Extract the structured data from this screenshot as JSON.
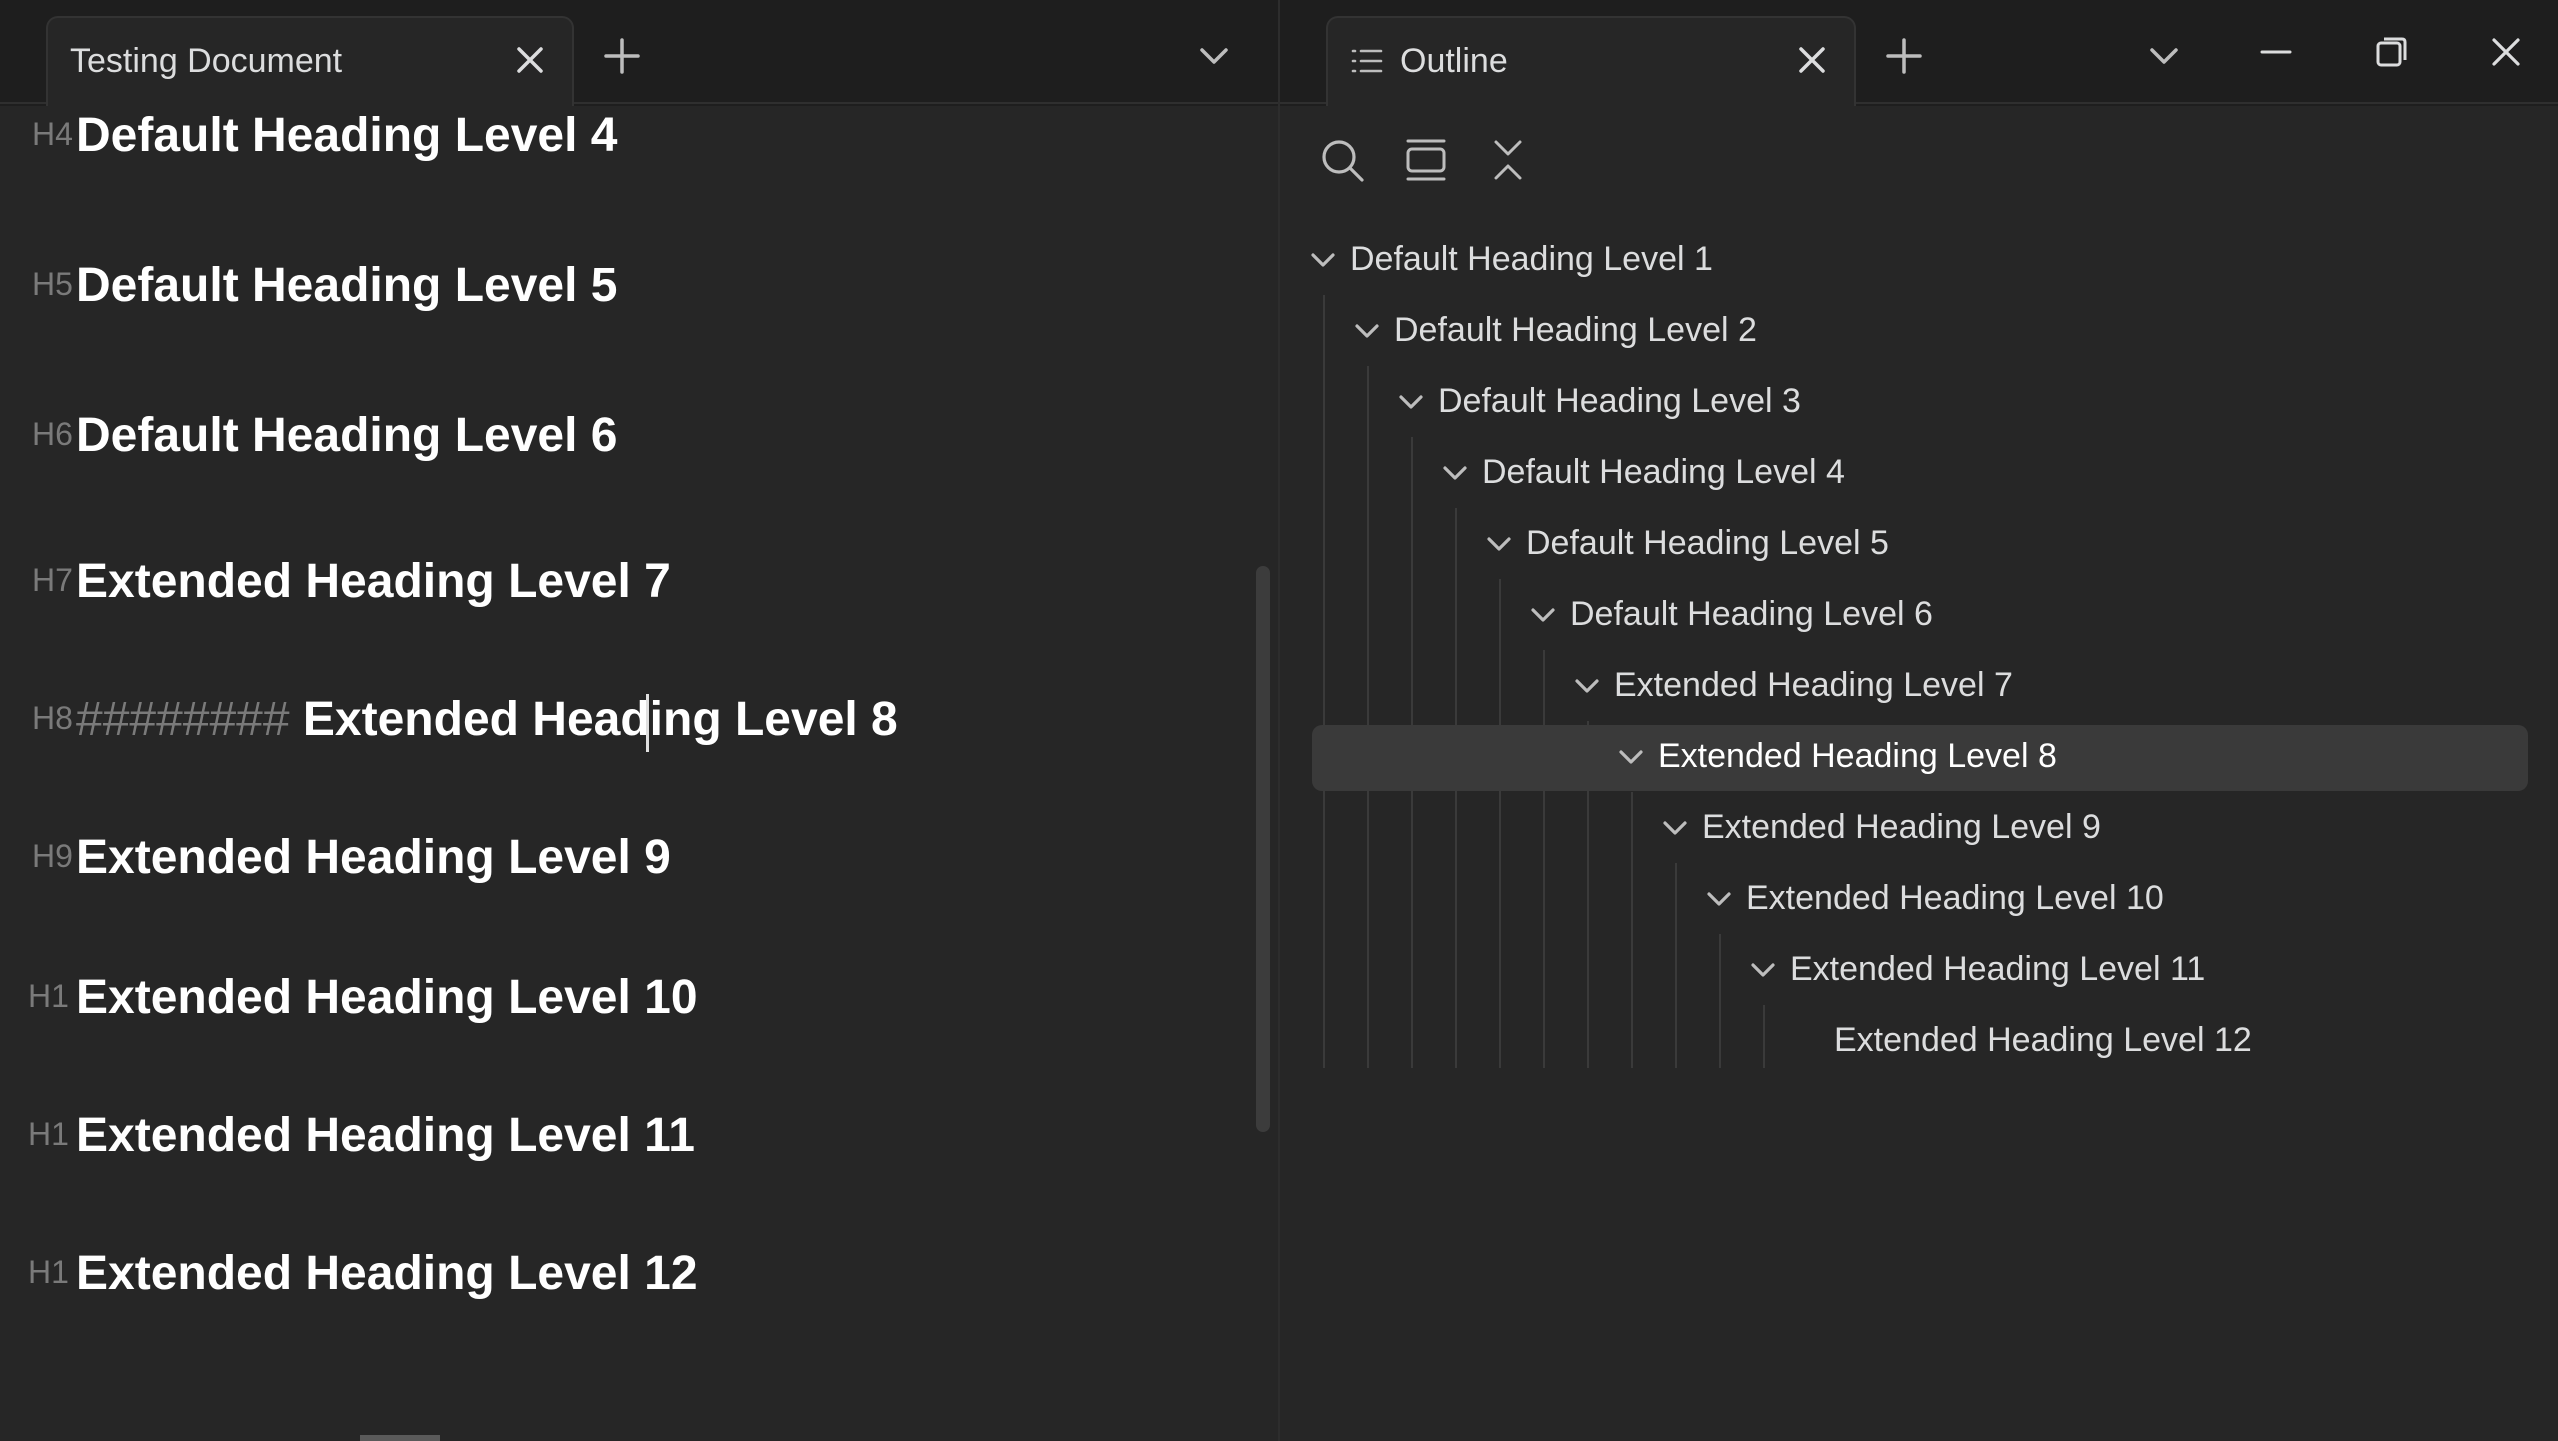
{
  "left_pane": {
    "tab_title": "Testing Document",
    "headings": [
      {
        "marker": "H4",
        "text": "Default Heading Level 4"
      },
      {
        "marker": "H5",
        "text": "Default Heading Level 5"
      },
      {
        "marker": "H6",
        "text": "Default Heading Level 6"
      },
      {
        "marker": "H7",
        "text": "Extended Heading Level 7"
      },
      {
        "marker": "H8",
        "hashes": "########",
        "text": "Extended Heading Level 8"
      },
      {
        "marker": "H9",
        "text": "Extended Heading Level 9"
      },
      {
        "marker": "H1",
        "text": "Extended Heading Level 10"
      },
      {
        "marker": "H1",
        "text": "Extended Heading Level 11"
      },
      {
        "marker": "H1",
        "text": "Extended Heading Level 12"
      }
    ]
  },
  "right_pane": {
    "tab_title": "Outline",
    "outline_items": [
      {
        "label": "Default Heading Level 1",
        "level": 1,
        "has_children": true
      },
      {
        "label": "Default Heading Level 2",
        "level": 2,
        "has_children": true
      },
      {
        "label": "Default Heading Level 3",
        "level": 3,
        "has_children": true
      },
      {
        "label": "Default Heading Level 4",
        "level": 4,
        "has_children": true
      },
      {
        "label": "Default Heading Level 5",
        "level": 5,
        "has_children": true
      },
      {
        "label": "Default Heading Level 6",
        "level": 6,
        "has_children": true
      },
      {
        "label": "Extended Heading Level 7",
        "level": 7,
        "has_children": true
      },
      {
        "label": "Extended Heading Level 8",
        "level": 8,
        "has_children": true,
        "selected": true
      },
      {
        "label": "Extended Heading Level 9",
        "level": 9,
        "has_children": true
      },
      {
        "label": "Extended Heading Level 10",
        "level": 10,
        "has_children": true
      },
      {
        "label": "Extended Heading Level 11",
        "level": 11,
        "has_children": true
      },
      {
        "label": "Extended Heading Level 12",
        "level": 12,
        "has_children": false
      }
    ]
  },
  "colors": {
    "accent": "#1473e6",
    "background": "#1e1e1e",
    "editor_background": "#262626",
    "selected_row": "#3a3a3a"
  }
}
